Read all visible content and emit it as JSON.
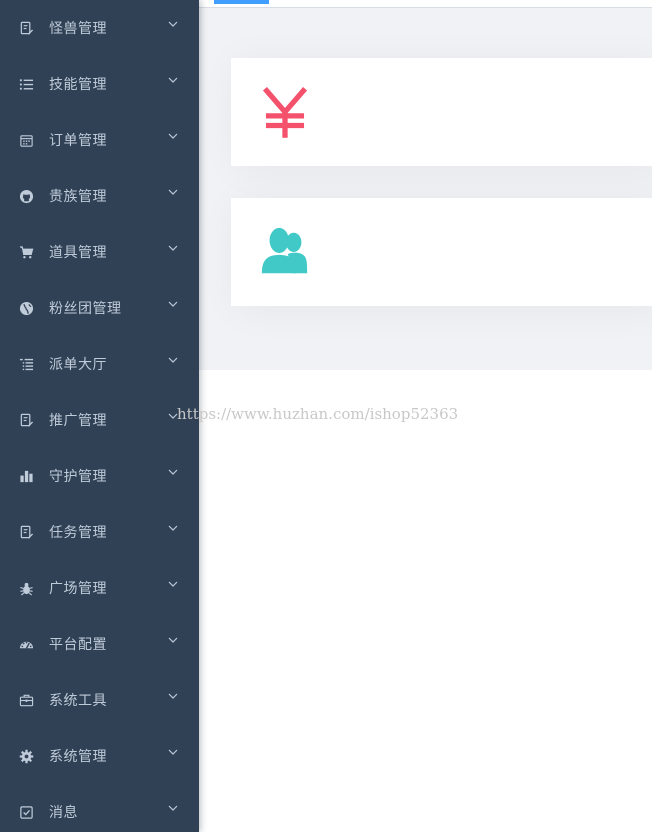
{
  "sidebar": {
    "items": [
      {
        "label": "怪兽管理",
        "icon": "edit-form-icon"
      },
      {
        "label": "技能管理",
        "icon": "list-icon"
      },
      {
        "label": "订单管理",
        "icon": "calendar-icon"
      },
      {
        "label": "贵族管理",
        "icon": "github-icon"
      },
      {
        "label": "道具管理",
        "icon": "shopping-cart-icon"
      },
      {
        "label": "粉丝团管理",
        "icon": "globe-icon"
      },
      {
        "label": "派单大厅",
        "icon": "tree-list-icon"
      },
      {
        "label": "推广管理",
        "icon": "edit-form-icon"
      },
      {
        "label": "守护管理",
        "icon": "bar-chart-icon"
      },
      {
        "label": "任务管理",
        "icon": "edit-form-icon"
      },
      {
        "label": "广场管理",
        "icon": "bug-icon"
      },
      {
        "label": "平台配置",
        "icon": "dashboard-icon"
      },
      {
        "label": "系统工具",
        "icon": "toolbox-icon"
      },
      {
        "label": "系统管理",
        "icon": "gear-icon"
      },
      {
        "label": "消息",
        "icon": "checkbox-icon"
      }
    ]
  },
  "main": {
    "panels": [
      {
        "icon": "yen-icon",
        "color": "#f4516c"
      },
      {
        "icon": "peoples-icon",
        "color": "#40c9c6"
      }
    ]
  },
  "watermark": "https://www.huzhan.com/ishop52363",
  "colors": {
    "sidebar_bg": "#304156",
    "sidebar_text": "#bfcbd9",
    "active_tab": "#409eff",
    "dashboard_bg": "#f0f2f5"
  }
}
